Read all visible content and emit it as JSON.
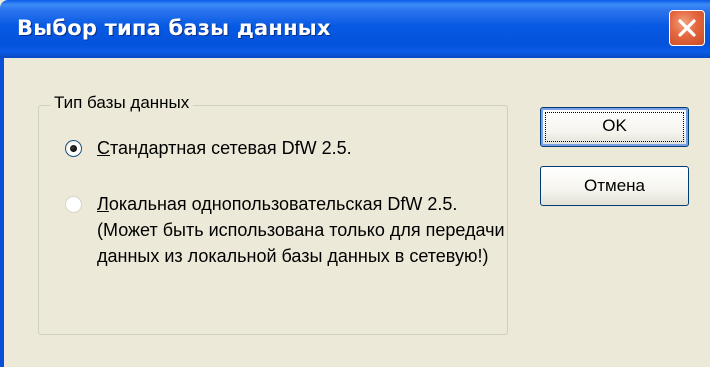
{
  "window": {
    "title": "Выбор типа базы данных"
  },
  "group": {
    "label": "Тип базы данных",
    "options": [
      {
        "accel": "С",
        "label_rest": "тандартная сетевая DfW 2.5.",
        "checked": true
      },
      {
        "accel": "Л",
        "label_rest": "окальная однопользовательская DfW 2.5. (Может быть использована только для передачи данных из локальной базы данных в сетевую!)",
        "checked": false
      }
    ]
  },
  "buttons": {
    "ok_label": "OK",
    "cancel_label": "Отмена"
  },
  "icons": {
    "close": "close-icon",
    "radio_checked": "radio-checked",
    "radio_unchecked": "radio-unchecked"
  },
  "colors": {
    "titlebar": "#0553dd",
    "face": "#ece9d8",
    "close": "#e4663f"
  }
}
